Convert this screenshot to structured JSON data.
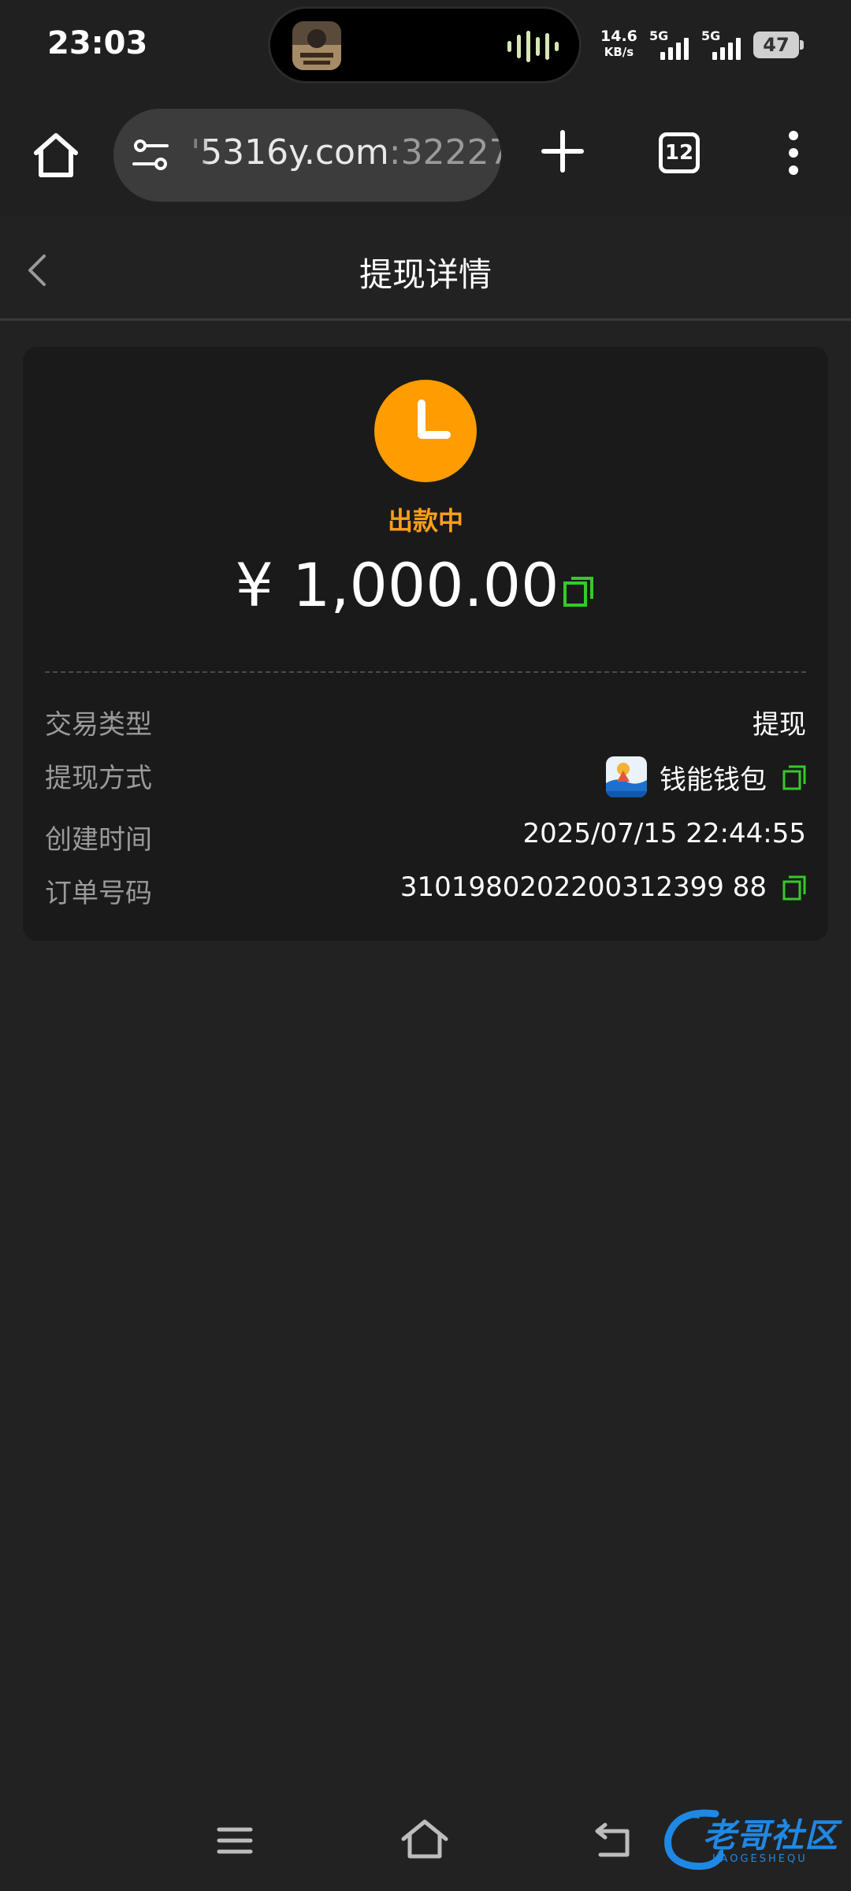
{
  "status_bar": {
    "time": "23:03",
    "net_speed_value": "14.6",
    "net_speed_unit": "KB/s",
    "sim1_label": "5G",
    "sim2_label": "5G",
    "battery_level": "47"
  },
  "browser": {
    "url_host": "'5316y.com",
    "url_port": ":32227",
    "tab_count": "12"
  },
  "header": {
    "title": "提现详情"
  },
  "detail": {
    "status": "出款中",
    "amount": "¥ 1,000.00",
    "rows": [
      {
        "label": "交易类型",
        "value": "提现"
      },
      {
        "label": "提现方式",
        "value": "钱能钱包"
      },
      {
        "label": "创建时间",
        "value": "2025/07/15 22:44:55"
      },
      {
        "label": "订单号码",
        "value": "3101980202200312399 88"
      }
    ]
  },
  "watermark": {
    "text": "老哥社区",
    "sub": "LAOGESHEQU"
  },
  "colors": {
    "accent_orange": "#ff9c00",
    "copy_green": "#36c92a",
    "background": "#222222",
    "card": "#1a1a1a"
  }
}
